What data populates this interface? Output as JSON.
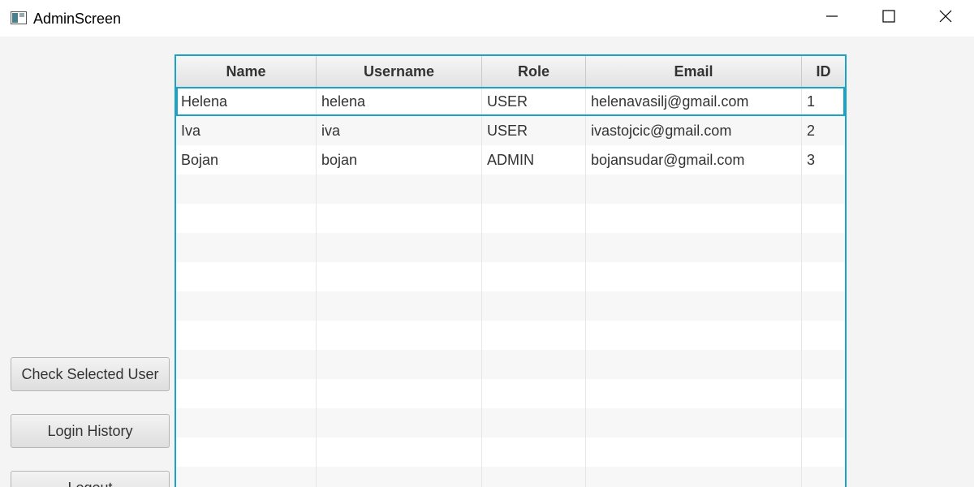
{
  "window": {
    "title": "AdminScreen",
    "icons": {
      "app": "app-window-icon",
      "minimize": "minimize-icon",
      "maximize": "maximize-icon",
      "close": "close-icon"
    }
  },
  "sidebar": {
    "check_selected_user": "Check Selected User",
    "login_history": "Login History",
    "logout": "Logout"
  },
  "table": {
    "headers": [
      "Name",
      "Username",
      "Role",
      "Email",
      "ID"
    ],
    "rows": [
      [
        "Helena",
        "helena",
        "USER",
        "helenavasilj@gmail.com",
        "1"
      ],
      [
        "Iva",
        "iva",
        "USER",
        "ivastojcic@gmail.com",
        "2"
      ],
      [
        "Bojan",
        "bojan",
        "ADMIN",
        "bojansudar@gmail.com",
        "3"
      ]
    ],
    "selected_row": 0,
    "accent_color": "#1ba3c6"
  }
}
